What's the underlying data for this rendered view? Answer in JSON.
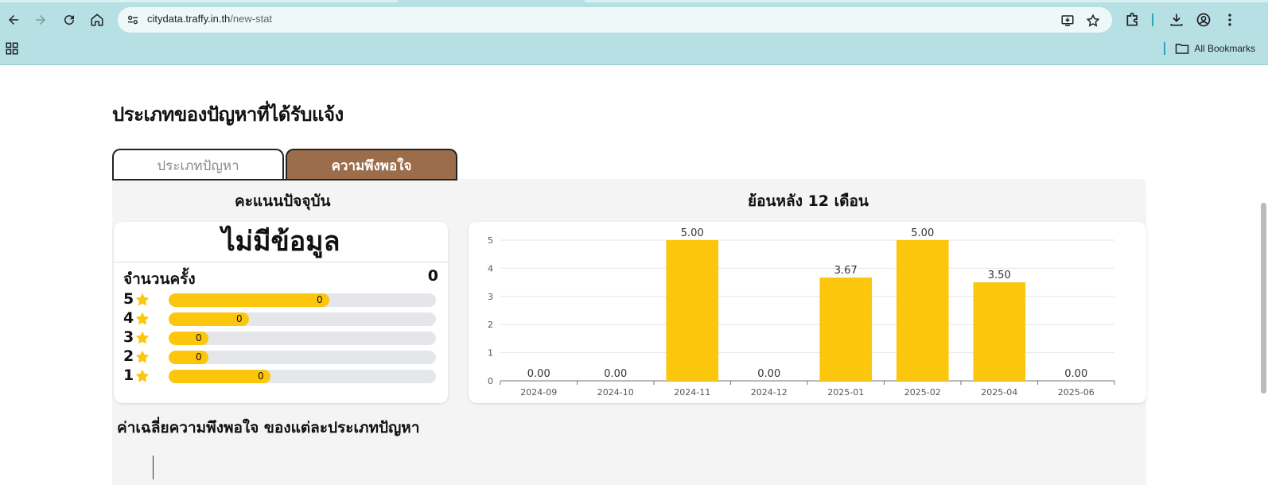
{
  "browser": {
    "url_host": "citydata.traffy.in.th",
    "url_path": "/new-stat",
    "bookmarks_label": "All Bookmarks"
  },
  "page": {
    "section_title": "ประเภทของปัญหาที่ได้รับแจ้ง",
    "tabs": [
      {
        "label": "ประเภทปัญหา",
        "active": false
      },
      {
        "label": "ความพึงพอใจ",
        "active": true
      }
    ],
    "current_score": {
      "heading": "คะแนนปัจจุบัน",
      "no_data": "ไม่มีข้อมูล",
      "count_label": "จำนวนครั้ง",
      "count_value": "0",
      "ratings": [
        {
          "stars": "5",
          "value": "0",
          "fill": 0.6
        },
        {
          "stars": "4",
          "value": "0",
          "fill": 0.3
        },
        {
          "stars": "3",
          "value": "0",
          "fill": 0.15
        },
        {
          "stars": "2",
          "value": "0",
          "fill": 0.15
        },
        {
          "stars": "1",
          "value": "0",
          "fill": 0.38
        }
      ]
    },
    "history_heading": "ย้อนหลัง 12 เดือน",
    "average_title": "ค่าเฉลี่ยความพึงพอใจ ของแต่ละประเภทปัญหา"
  },
  "colors": {
    "bar": "#fcc60d",
    "active_tab": "#9b6d4b",
    "chrome": "#b7e0e4"
  },
  "chart_data": {
    "type": "bar",
    "categories": [
      "2024-09",
      "2024-10",
      "2024-11",
      "2024-12",
      "2025-01",
      "2025-02",
      "2025-04",
      "2025-06"
    ],
    "values": [
      0,
      0,
      5,
      0,
      3.67,
      5,
      3.5,
      0
    ],
    "labels": [
      "0.00",
      "0.00",
      "5.00",
      "0.00",
      "3.67",
      "5.00",
      "3.50",
      "0.00"
    ],
    "yticks": [
      "0",
      "1",
      "2",
      "3",
      "4",
      "5"
    ],
    "ylim": [
      0,
      5
    ],
    "grid": true,
    "legend": "none"
  }
}
